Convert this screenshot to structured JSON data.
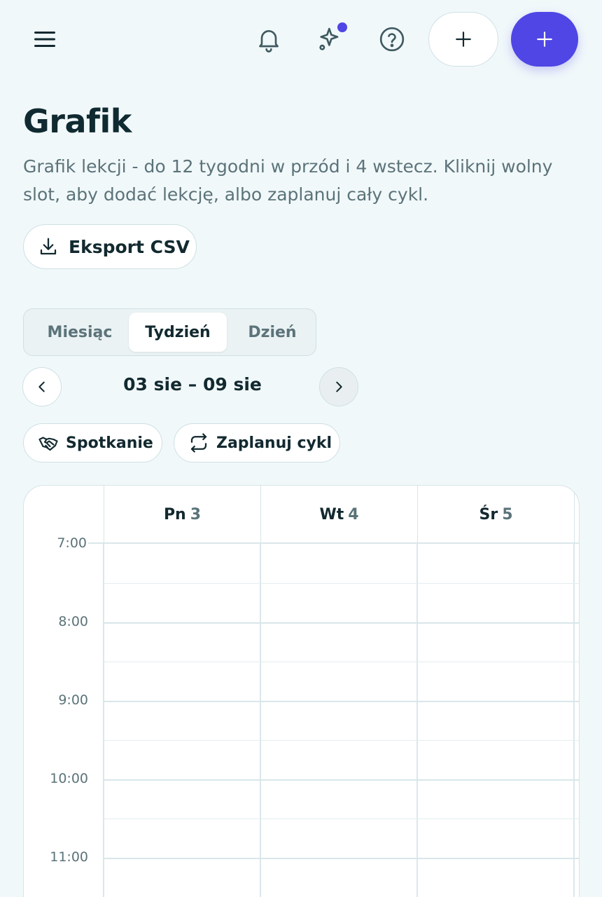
{
  "topbar": {
    "menu_icon": "menu-icon",
    "bell_icon": "bell-icon",
    "sparkle_icon": "sparkle-icon",
    "help_icon": "help-icon",
    "accent": "#4f46e5"
  },
  "page": {
    "title": "Grafik",
    "subtitle": "Grafik lekcji - do 12 tygodni w przód i 4 wstecz. Kliknij wolny slot, aby dodać lekcję, albo zaplanuj cały cykl.",
    "export_label": "Eksport CSV"
  },
  "view_tabs": {
    "month": "Miesiąc",
    "week": "Tydzień",
    "day": "Dzień",
    "selected": "Tydzień"
  },
  "date_nav": {
    "range": "03 sie – 09 sie"
  },
  "actions": {
    "meeting": "Spotkanie",
    "cycle": "Zaplanuj cykl"
  },
  "calendar": {
    "days": [
      {
        "name": "Pn",
        "num": "3"
      },
      {
        "name": "Wt",
        "num": "4"
      },
      {
        "name": "Śr",
        "num": "5"
      }
    ],
    "hours": [
      "7:00",
      "8:00",
      "9:00",
      "10:00",
      "11:00"
    ]
  }
}
